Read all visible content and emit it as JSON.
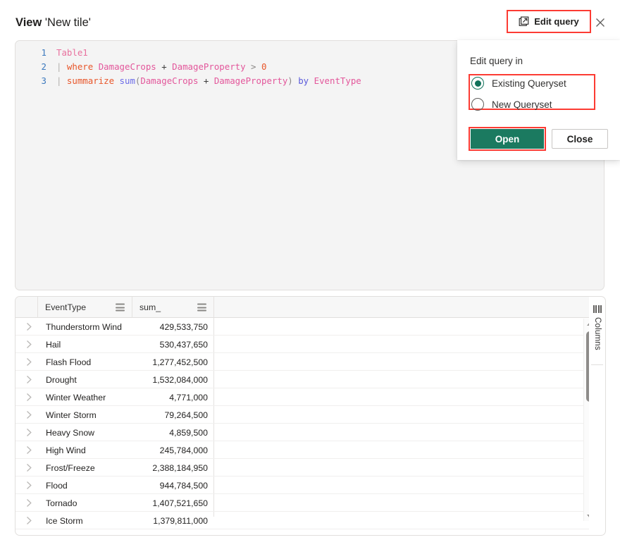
{
  "header": {
    "title_bold": "View",
    "title_rest": "'New tile'",
    "edit_query_label": "Edit query",
    "edit_query_icon": "external-link-icon",
    "close_icon": "close-icon"
  },
  "query_editor": {
    "lines": [
      {
        "number": "1",
        "tokens": [
          {
            "t": "Table1",
            "c": "tok-table"
          }
        ]
      },
      {
        "number": "2",
        "tokens": [
          {
            "t": "| ",
            "c": "tok-pipe"
          },
          {
            "t": "where",
            "c": "tok-kw"
          },
          {
            "t": " ",
            "c": "tok-plus"
          },
          {
            "t": "DamageCrops",
            "c": "tok-col"
          },
          {
            "t": " + ",
            "c": "tok-plus"
          },
          {
            "t": "DamageProperty",
            "c": "tok-col"
          },
          {
            "t": " > ",
            "c": "tok-op"
          },
          {
            "t": "0",
            "c": "tok-num"
          }
        ]
      },
      {
        "number": "3",
        "tokens": [
          {
            "t": "| ",
            "c": "tok-pipe"
          },
          {
            "t": "summarize",
            "c": "tok-kw"
          },
          {
            "t": " ",
            "c": "tok-plus"
          },
          {
            "t": "sum",
            "c": "tok-fn"
          },
          {
            "t": "(",
            "c": "tok-paren"
          },
          {
            "t": "DamageCrops",
            "c": "tok-col"
          },
          {
            "t": " + ",
            "c": "tok-plus"
          },
          {
            "t": "DamageProperty",
            "c": "tok-col"
          },
          {
            "t": ")",
            "c": "tok-paren"
          },
          {
            "t": " ",
            "c": "tok-plus"
          },
          {
            "t": "by",
            "c": "tok-by"
          },
          {
            "t": " ",
            "c": "tok-plus"
          },
          {
            "t": "EventType",
            "c": "tok-col"
          }
        ]
      }
    ]
  },
  "dialog": {
    "label": "Edit query in",
    "options": [
      {
        "label": "Existing Queryset",
        "selected": true
      },
      {
        "label": "New Queryset",
        "selected": false
      }
    ],
    "primary_button": "Open",
    "secondary_button": "Close"
  },
  "results_grid": {
    "columns": [
      {
        "header": "EventType",
        "menu_icon": "column-menu-icon"
      },
      {
        "header": "sum_",
        "menu_icon": "column-menu-icon"
      }
    ],
    "rows": [
      {
        "EventType": "Thunderstorm Wind",
        "sum_": "429,533,750"
      },
      {
        "EventType": "Hail",
        "sum_": "530,437,650"
      },
      {
        "EventType": "Flash Flood",
        "sum_": "1,277,452,500"
      },
      {
        "EventType": "Drought",
        "sum_": "1,532,084,000"
      },
      {
        "EventType": "Winter Weather",
        "sum_": "4,771,000"
      },
      {
        "EventType": "Winter Storm",
        "sum_": "79,264,500"
      },
      {
        "EventType": "Heavy Snow",
        "sum_": "4,859,500"
      },
      {
        "EventType": "High Wind",
        "sum_": "245,784,000"
      },
      {
        "EventType": "Frost/Freeze",
        "sum_": "2,388,184,950"
      },
      {
        "EventType": "Flood",
        "sum_": "944,784,500"
      },
      {
        "EventType": "Tornado",
        "sum_": "1,407,521,650"
      },
      {
        "EventType": "Ice Storm",
        "sum_": "1,379,811,000"
      }
    ]
  },
  "columns_panel": {
    "label": "Columns",
    "icon": "columns-icon"
  },
  "colors": {
    "highlight_red": "#fc3b33",
    "primary_green": "#1b7a60",
    "radio_green": "#11715a"
  }
}
